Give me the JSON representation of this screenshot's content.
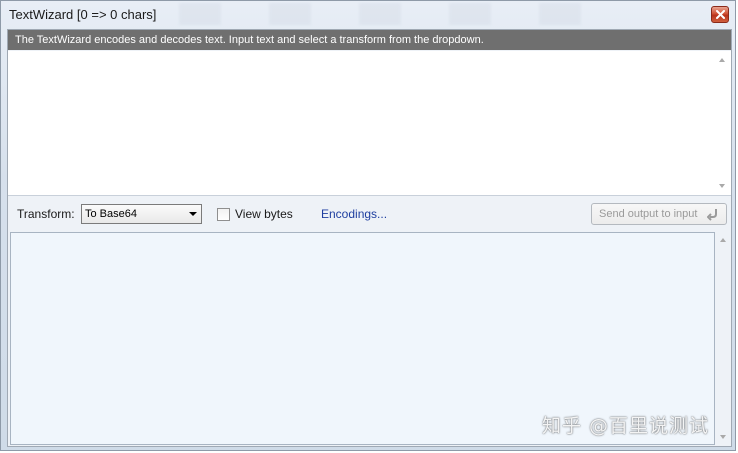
{
  "window": {
    "title": "TextWizard [0 => 0 chars]"
  },
  "info_bar": {
    "text": "The TextWizard encodes and decodes text. Input text and select a transform from the dropdown."
  },
  "input": {
    "value": ""
  },
  "toolbar": {
    "transform_label": "Transform:",
    "transform_selected": "To Base64",
    "view_bytes_label": "View bytes",
    "view_bytes_checked": false,
    "encodings_link": "Encodings...",
    "send_button_label": "Send output to input"
  },
  "output": {
    "value": ""
  },
  "watermark": {
    "text": "知乎 @百里说测试"
  },
  "colors": {
    "info_bar_bg": "#6f6f6f",
    "output_bg": "#f0f6fc",
    "link": "#1f3fa0",
    "close_button": "#cf4f33"
  },
  "icons": {
    "close": "close-icon",
    "send": "return-arrow-icon"
  }
}
